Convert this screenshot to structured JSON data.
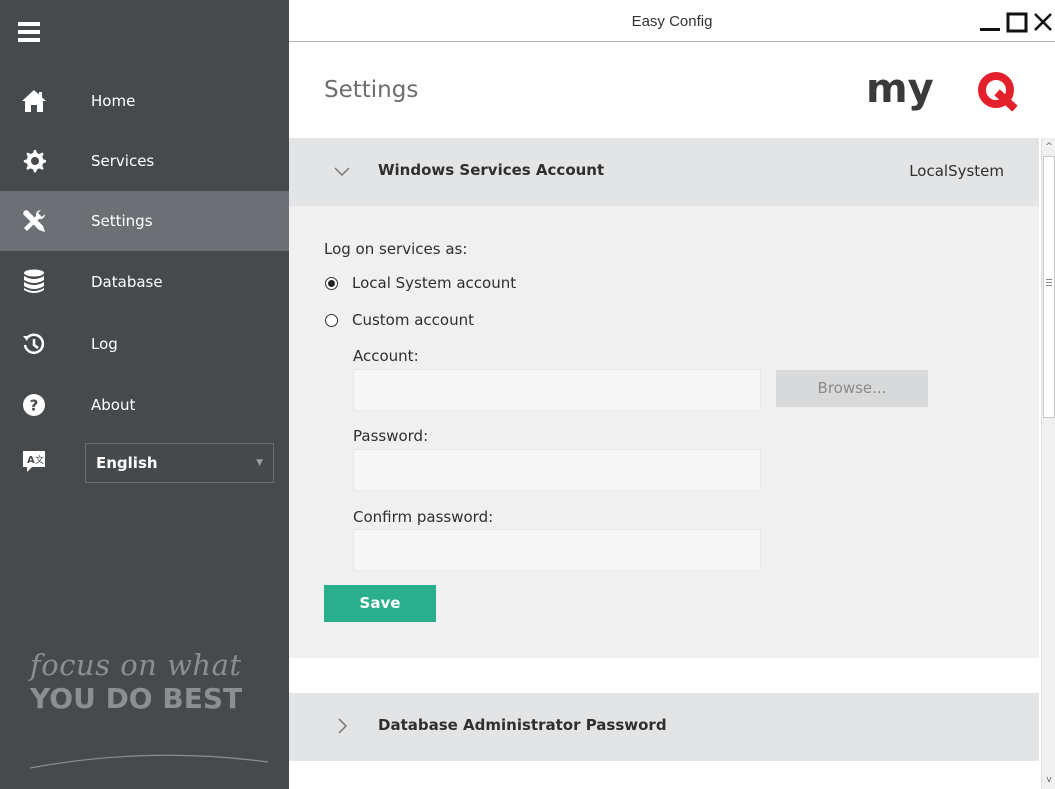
{
  "window": {
    "title": "Easy Config"
  },
  "sidebar": {
    "items": [
      {
        "label": "Home",
        "icon": "home-icon"
      },
      {
        "label": "Services",
        "icon": "gear-icon"
      },
      {
        "label": "Settings",
        "icon": "wrench-screwdriver-icon",
        "active": true
      },
      {
        "label": "Database",
        "icon": "database-icon"
      },
      {
        "label": "Log",
        "icon": "history-icon"
      },
      {
        "label": "About",
        "icon": "question-icon"
      }
    ],
    "language": {
      "selected": "English",
      "icon": "translate-icon"
    },
    "tagline": {
      "line1": "focus on what",
      "line2": "YOU DO BEST"
    }
  },
  "header": {
    "page_title": "Settings",
    "logo": "myQ"
  },
  "sections": {
    "windows_services": {
      "title": "Windows Services Account",
      "value": "LocalSystem",
      "expanded": true,
      "log_on_label": "Log on services as:",
      "options": [
        {
          "label": "Local System account",
          "checked": true
        },
        {
          "label": "Custom account",
          "checked": false
        }
      ],
      "account_label": "Account:",
      "account_value": "",
      "browse_label": "Browse...",
      "password_label": "Password:",
      "password_value": "",
      "confirm_label": "Confirm password:",
      "confirm_value": "",
      "save_label": "Save"
    },
    "db_admin": {
      "title": "Database Administrator Password",
      "expanded": false
    }
  },
  "colors": {
    "sidebar_bg": "#464a4d",
    "sidebar_active": "#6c7075",
    "section_header": "#e3e4e5",
    "section_body": "#f0f0f0",
    "save_button": "#2bae8c",
    "logo_red": "#e3202b"
  }
}
